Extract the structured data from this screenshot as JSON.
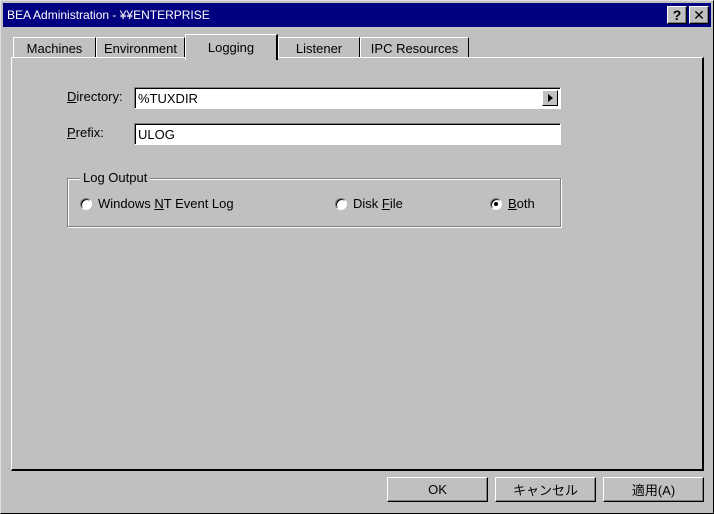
{
  "window": {
    "title": "BEA Administration - ¥¥ENTERPRISE",
    "help_label": "?",
    "close_label": "✕"
  },
  "tabs": [
    {
      "label": "Machines",
      "active": false
    },
    {
      "label": "Environment",
      "active": false
    },
    {
      "label": "Logging",
      "active": true
    },
    {
      "label": "Listener",
      "active": false
    },
    {
      "label": "IPC Resources",
      "active": false
    }
  ],
  "logging": {
    "directory": {
      "label_mnemonic": "D",
      "label_rest": "irectory:",
      "value": "%TUXDIR"
    },
    "prefix": {
      "label_mnemonic": "P",
      "label_rest": "refix:",
      "value": "ULOG"
    },
    "log_output": {
      "title": "Log Output",
      "options": [
        {
          "pre": "Windows ",
          "mnemonic": "N",
          "post": "T Event Log",
          "selected": false
        },
        {
          "pre": "Disk ",
          "mnemonic": "F",
          "post": "ile",
          "selected": false
        },
        {
          "pre": "",
          "mnemonic": "B",
          "post": "oth",
          "selected": true
        }
      ]
    }
  },
  "buttons": {
    "ok": "OK",
    "cancel": "キャンセル",
    "apply": "適用(A)"
  }
}
